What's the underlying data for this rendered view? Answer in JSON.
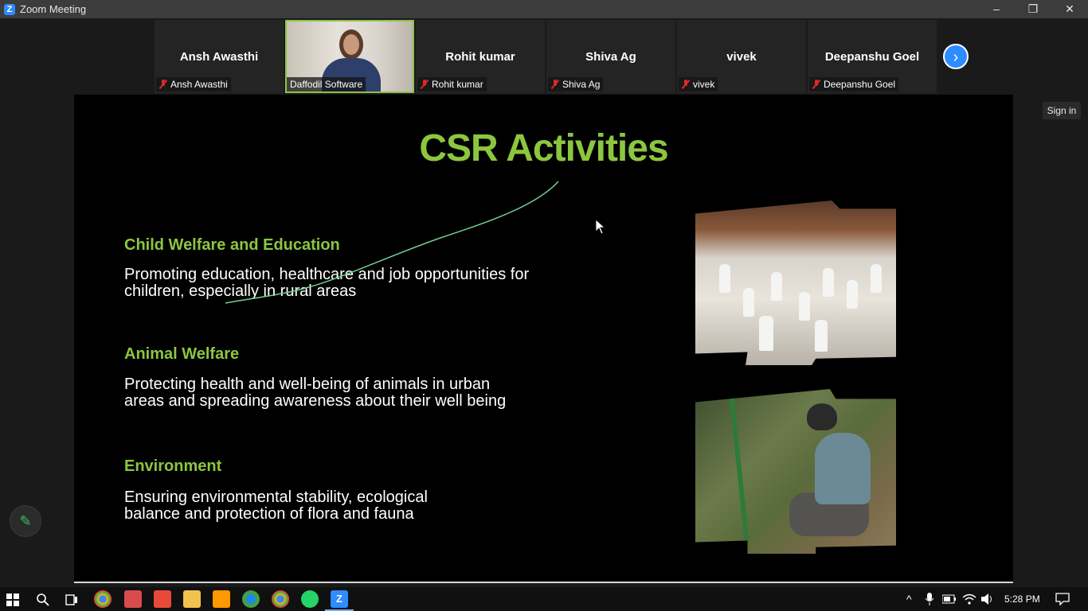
{
  "window": {
    "title": "Zoom Meeting",
    "logo_letter": "Z",
    "min_glyph": "–",
    "restore_glyph": "❐",
    "close_glyph": "✕"
  },
  "participants": [
    {
      "display": "Ansh Awasthi",
      "label": "Ansh Awasthi",
      "muted": true
    },
    {
      "display": "",
      "label": "Daffodil Software",
      "muted": false,
      "video": true
    },
    {
      "display": "Rohit kumar",
      "label": "Rohit kumar",
      "muted": true
    },
    {
      "display": "Shiva Ag",
      "label": "Shiva Ag",
      "muted": true
    },
    {
      "display": "vivek",
      "label": "vivek",
      "muted": true
    },
    {
      "display": "Deepanshu Goel",
      "label": "Deepanshu Goel",
      "muted": true
    }
  ],
  "next_arrow": "›",
  "sign_in": "Sign in",
  "pencil_glyph": "✎",
  "slide": {
    "title": "CSR Activities",
    "sections": [
      {
        "heading": "Child Welfare and Education",
        "body": "Promoting education, healthcare and job opportunities for children, especially in rural areas"
      },
      {
        "heading": "Animal Welfare",
        "body": "Protecting health and well-being of animals in urban areas and spreading awareness about their well being"
      },
      {
        "heading": "Environment",
        "body": "Ensuring environmental stability, ecological balance and protection of flora and fauna"
      }
    ]
  },
  "colors": {
    "accent_green": "#8cc63f",
    "zoom_blue": "#2d8cff",
    "mute_red": "#e02828"
  },
  "taskbar": {
    "icons": [
      "windows-icon",
      "search-icon",
      "task-view-icon",
      "chrome-icon",
      "snipping-icon",
      "anydesk-icon",
      "file-explorer-icon",
      "sublime-icon",
      "edge-icon",
      "chrome-icon",
      "whatsapp-icon",
      "zoom-icon"
    ],
    "clock": "5:28 PM"
  }
}
